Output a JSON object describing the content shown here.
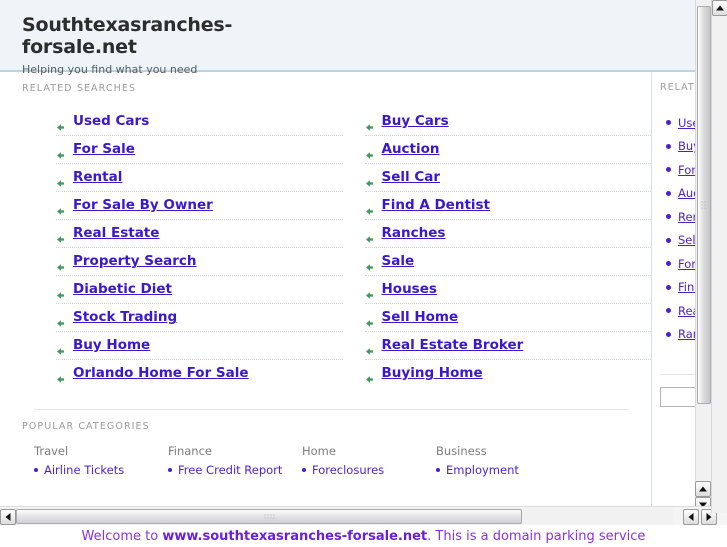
{
  "header": {
    "title": "Southtexasranches-forsale.net",
    "tagline": "Helping you find what you need"
  },
  "main": {
    "related_searches_label": "RELATED SEARCHES",
    "popular_categories_label": "POPULAR CATEGORIES",
    "links_left": [
      "Used Cars",
      "For Sale",
      "Rental",
      "For Sale By Owner",
      "Real Estate",
      "Property Search",
      "Diabetic Diet",
      "Stock Trading",
      "Buy Home",
      "Orlando Home For Sale"
    ],
    "links_right": [
      "Buy Cars",
      "Auction",
      "Sell Car",
      "Find A Dentist",
      "Ranches",
      "Sale",
      "Houses",
      "Sell Home",
      "Real Estate Broker",
      "Buying Home"
    ],
    "categories": [
      {
        "title": "Travel",
        "items": [
          "Airline Tickets"
        ]
      },
      {
        "title": "Finance",
        "items": [
          "Free Credit Report"
        ]
      },
      {
        "title": "Home",
        "items": [
          "Foreclosures"
        ]
      },
      {
        "title": "Business",
        "items": [
          "Employment"
        ]
      }
    ]
  },
  "sidebar": {
    "label": "RELATED",
    "items": [
      "Used Cars",
      "Buy Cars",
      "For Sale",
      "Auction",
      "Rental",
      "Sell Car",
      "For Sale By Owner",
      "Find A Dentist",
      "Real Estate",
      "Ranches"
    ],
    "search_value": "",
    "search_placeholder": ""
  },
  "footer": {
    "welcome_prefix": "Welcome to ",
    "domain": "www.southtexasranches-forsale.net",
    "welcome_suffix": ". This is a domain parking service"
  },
  "colors": {
    "link": "#3b17cf",
    "bullet_green": "#3d9a5c",
    "header_bg": "#eef4f7",
    "welcome": "#8b2ff0"
  },
  "icons": {
    "bullet": "arrow-bullet-icon",
    "scroll_up": "scroll-up-arrow-icon",
    "scroll_down": "scroll-down-arrow-icon",
    "scroll_left": "scroll-left-arrow-icon",
    "scroll_right": "scroll-right-arrow-icon"
  }
}
